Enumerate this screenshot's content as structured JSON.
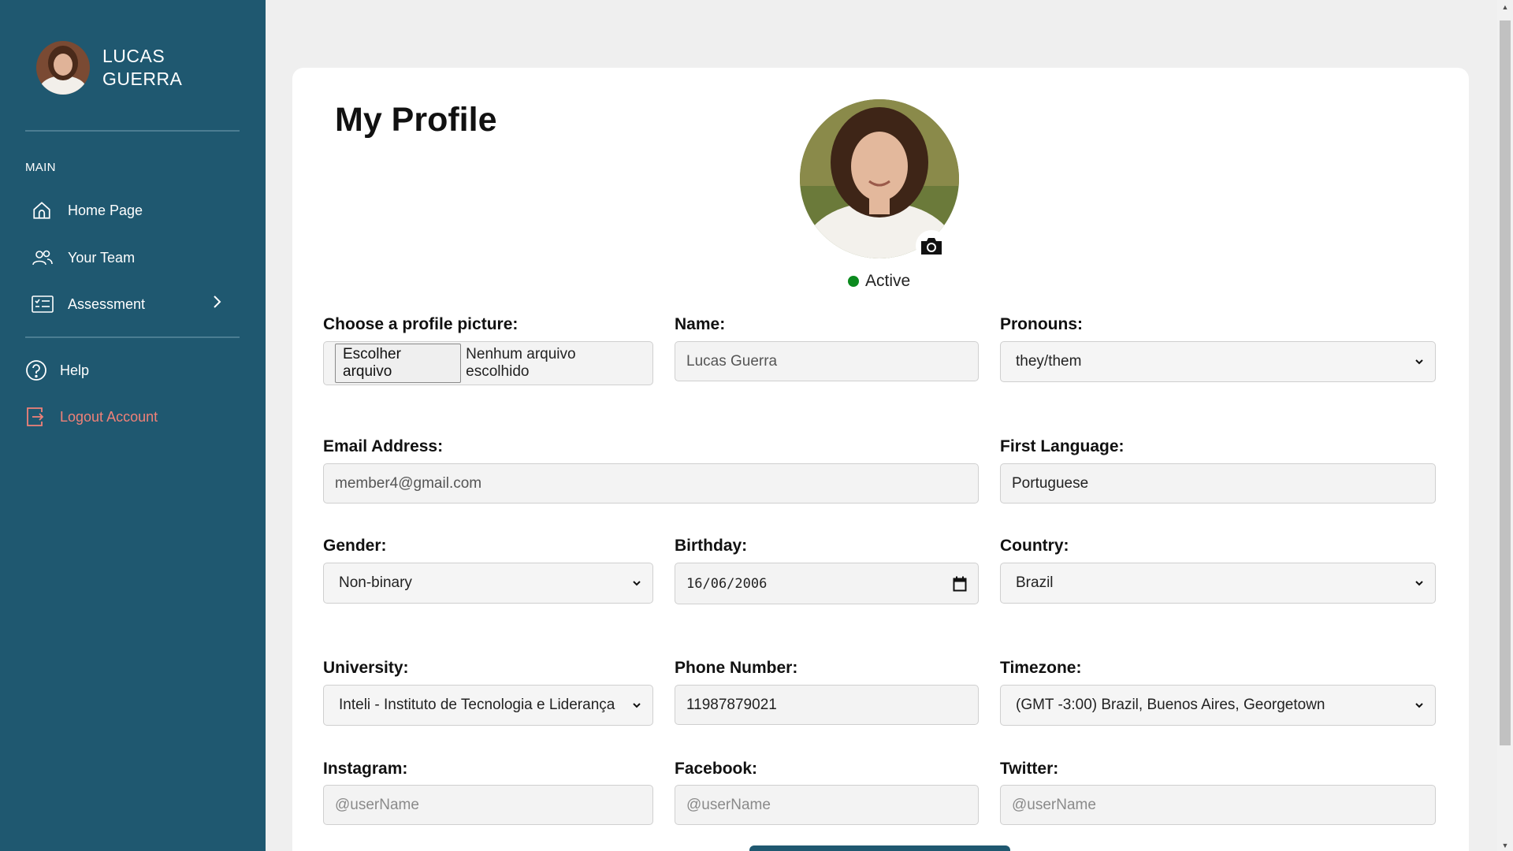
{
  "sidebar": {
    "user_name": "LUCAS GUERRA",
    "section_label": "MAIN",
    "items": [
      {
        "label": "Home Page",
        "icon": "home-icon"
      },
      {
        "label": "Your Team",
        "icon": "team-icon"
      },
      {
        "label": "Assessment",
        "icon": "assessment-icon"
      }
    ],
    "help_label": "Help",
    "logout_label": "Logout Account",
    "colors": {
      "background": "#1f5870",
      "logout": "#f08178"
    }
  },
  "main": {
    "title": "My Profile",
    "status": "Active",
    "status_color": "#0b8a1e",
    "fields": {
      "profile_picture": {
        "label": "Choose a profile picture:",
        "button": "Escolher arquivo",
        "value": "Nenhum arquivo escolhido"
      },
      "name": {
        "label": "Name:",
        "value": "Lucas Guerra"
      },
      "pronouns": {
        "label": "Pronouns:",
        "value": "they/them"
      },
      "email": {
        "label": "Email Address:",
        "value": "member4@gmail.com"
      },
      "first_language": {
        "label": "First Language:",
        "value": "Portuguese"
      },
      "gender": {
        "label": "Gender:",
        "value": "Non-binary"
      },
      "birthday": {
        "label": "Birthday:",
        "value": "16/06/2006"
      },
      "country": {
        "label": "Country:",
        "value": "Brazil"
      },
      "university": {
        "label": "University:",
        "value": "Inteli - Instituto de Tecnologia e Liderança"
      },
      "phone": {
        "label": "Phone Number:",
        "value": "11987879021"
      },
      "timezone": {
        "label": "Timezone:",
        "value": "(GMT -3:00) Brazil, Buenos Aires, Georgetown"
      },
      "instagram": {
        "label": "Instagram:",
        "placeholder": "@userName"
      },
      "facebook": {
        "label": "Facebook:",
        "placeholder": "@userName"
      },
      "twitter": {
        "label": "Twitter:",
        "placeholder": "@userName"
      }
    }
  }
}
